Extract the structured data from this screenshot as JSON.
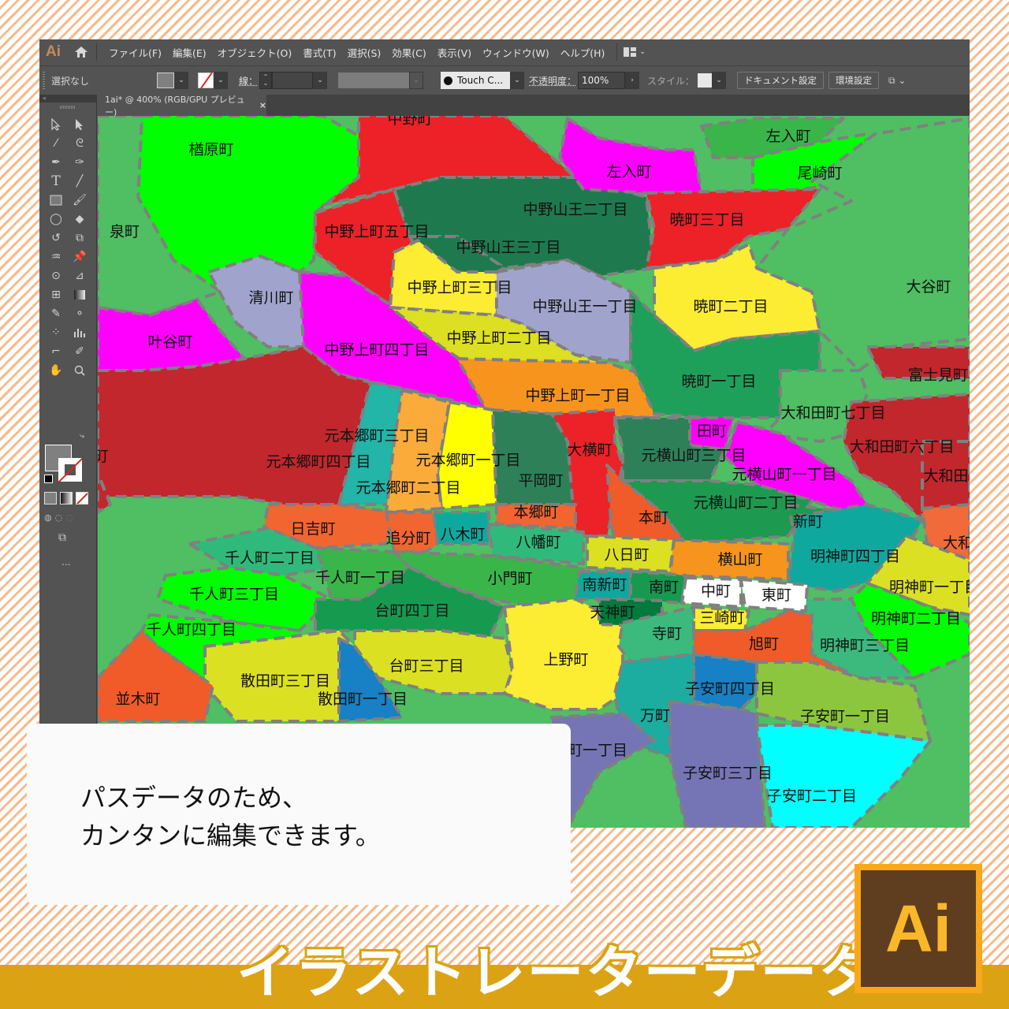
{
  "app": {
    "logo": "Ai",
    "menu": [
      "ファイル(F)",
      "編集(E)",
      "オブジェクト(O)",
      "書式(T)",
      "選択(S)",
      "効果(C)",
      "表示(V)",
      "ウィンドウ(W)",
      "ヘルプ(H)"
    ],
    "workspace_icon": "workspace-switcher-icon"
  },
  "control_bar": {
    "selection_status": "選択なし",
    "fill_color": "#808080",
    "stroke_label": "線：",
    "brush": "Touch C...",
    "opacity_label": "不透明度：",
    "opacity_value": "100%",
    "style_label": "スタイル：",
    "document_setup_button": "ドキュメント設定",
    "preferences_button": "環境設定"
  },
  "document_tab": {
    "title": "1ai* @ 400% (RGB/GPU プレビュー)",
    "close": "×"
  },
  "toolbar": {
    "tools": [
      "selection",
      "direct-selection",
      "magic-wand",
      "lasso",
      "pen",
      "curvature",
      "type",
      "line-segment",
      "rectangle",
      "paintbrush",
      "shaper",
      "eraser",
      "rotate",
      "scale",
      "warp",
      "puppet-warp",
      "free-transform",
      "perspective-grid",
      "mesh",
      "gradient",
      "eyedropper",
      "blend",
      "symbol-sprayer",
      "column-graph",
      "artboard",
      "slice",
      "hand",
      "zoom"
    ],
    "more": "..."
  },
  "map": {
    "border_color": "#808080",
    "regions": [
      {
        "name": "楢原町",
        "color": "#00ff00"
      },
      {
        "name": "泉町",
        "color": "#50be63"
      },
      {
        "name": "清川町",
        "color": "#a0a4cc"
      },
      {
        "name": "叶谷町",
        "color": "#ff00ff"
      },
      {
        "name": "中野町",
        "color": "#ed2128"
      },
      {
        "name": "中野上町五丁目",
        "color": "#ed2128"
      },
      {
        "name": "中野上町四丁目",
        "color": "#ff00ff"
      },
      {
        "name": "中野山王二丁目",
        "color": "#1e7a4e"
      },
      {
        "name": "中野山王三丁目",
        "color": "#1e7a4e"
      },
      {
        "name": "中野上町三丁目",
        "color": "#fcec32"
      },
      {
        "name": "中野山王一丁目",
        "color": "#a0a4cc"
      },
      {
        "name": "中野上町二丁目",
        "color": "#dcdf22"
      },
      {
        "name": "中野上町一丁目",
        "color": "#f7941d"
      },
      {
        "name": "左入町",
        "color": "#ff00ff"
      },
      {
        "name": "左入町",
        "color": "#3ab54a"
      },
      {
        "name": "尾崎町",
        "color": "#00ff00"
      },
      {
        "name": "暁町三丁目",
        "color": "#ed2128"
      },
      {
        "name": "暁町二丁目",
        "color": "#fcec32"
      },
      {
        "name": "暁町一丁目",
        "color": "#1fa05a"
      },
      {
        "name": "大谷町",
        "color": "#50be63"
      },
      {
        "name": "富士見町",
        "color": "#c1272d"
      },
      {
        "name": "大和田町七丁目",
        "color": "#50be63"
      },
      {
        "name": "大和田町六丁目",
        "color": "#c1272d"
      },
      {
        "name": "大和田",
        "color": "#c1272d"
      },
      {
        "name": "元本郷町三丁目",
        "color": "#22b5a8"
      },
      {
        "name": "元本郷町四丁目",
        "color": "#c1272d"
      },
      {
        "name": "元本郷町一丁目",
        "color": "#ffff00"
      },
      {
        "name": "元本郷町二丁目",
        "color": "#fbab3a"
      },
      {
        "name": "平岡町",
        "color": "#2e8059"
      },
      {
        "name": "大横町",
        "color": "#ed2128"
      },
      {
        "name": "田町",
        "color": "#ff00ff"
      },
      {
        "name": "元横山町三丁目",
        "color": "#2e8059"
      },
      {
        "name": "元横山町一丁目",
        "color": "#ff00ff"
      },
      {
        "name": "元横山町二丁目",
        "color": "#1e9950"
      },
      {
        "name": "新町",
        "color": "#1e9950"
      },
      {
        "name": "本郷町",
        "color": "#f26531"
      },
      {
        "name": "本町",
        "color": "#f15a29"
      },
      {
        "name": "日吉町",
        "color": "#f26531"
      },
      {
        "name": "追分町",
        "color": "#f26531"
      },
      {
        "name": "八木町",
        "color": "#0ea89e"
      },
      {
        "name": "八幡町",
        "color": "#2fba7c"
      },
      {
        "name": "八日町",
        "color": "#dce022"
      },
      {
        "name": "横山町",
        "color": "#f7941d"
      },
      {
        "name": "明神町四丁目",
        "color": "#0ea89e"
      },
      {
        "name": "大和",
        "color": "#f06a3a"
      },
      {
        "name": "明神町一丁目",
        "color": "#dce022"
      },
      {
        "name": "明神町二丁目",
        "color": "#00ff00"
      },
      {
        "name": "明神町三丁目",
        "color": "#3cba7e"
      },
      {
        "name": "千人町二丁目",
        "color": "#2fba7c"
      },
      {
        "name": "千人町一丁目",
        "color": "#3ab54a"
      },
      {
        "name": "千人町三丁目",
        "color": "#00ff00"
      },
      {
        "name": "千人町四丁目",
        "color": "#00ff00"
      },
      {
        "name": "小門町",
        "color": "#3ab54a"
      },
      {
        "name": "台町四丁目",
        "color": "#169a50"
      },
      {
        "name": "台町三丁目",
        "color": "#dce022"
      },
      {
        "name": "上野町",
        "color": "#fcec32"
      },
      {
        "name": "南新町",
        "color": "#0ea89e"
      },
      {
        "name": "南町",
        "color": "#169a50"
      },
      {
        "name": "中町",
        "color": "#ffffff"
      },
      {
        "name": "東町",
        "color": "#ffffff"
      },
      {
        "name": "天神町",
        "color": "#007a3d"
      },
      {
        "name": "三崎町",
        "color": "#fcec32"
      },
      {
        "name": "寺町",
        "color": "#3cba7e"
      },
      {
        "name": "旭町",
        "color": "#f15a29"
      },
      {
        "name": "散田町三丁目",
        "color": "#dce022"
      },
      {
        "name": "散田町一丁目",
        "color": "#1880c4"
      },
      {
        "name": "並木町",
        "color": "#f15a29"
      },
      {
        "name": "子安町四丁目",
        "color": "#1880c4"
      },
      {
        "name": "子安町一丁目",
        "color": "#8cc63f"
      },
      {
        "name": "万町",
        "color": "#1caca0"
      },
      {
        "name": "子安町三丁目",
        "color": "#7575b5"
      },
      {
        "name": "子安町二丁目",
        "color": "#00ffff"
      },
      {
        "name": "町一丁目",
        "color": "#7575b5"
      },
      {
        "name": "町",
        "color": "#c1272d"
      }
    ]
  },
  "overlay": {
    "message_line1": "パスデータのため、",
    "message_line2": "カンタンに編集できます。",
    "title": "イラストレーターデータ",
    "badge": "Ai"
  }
}
